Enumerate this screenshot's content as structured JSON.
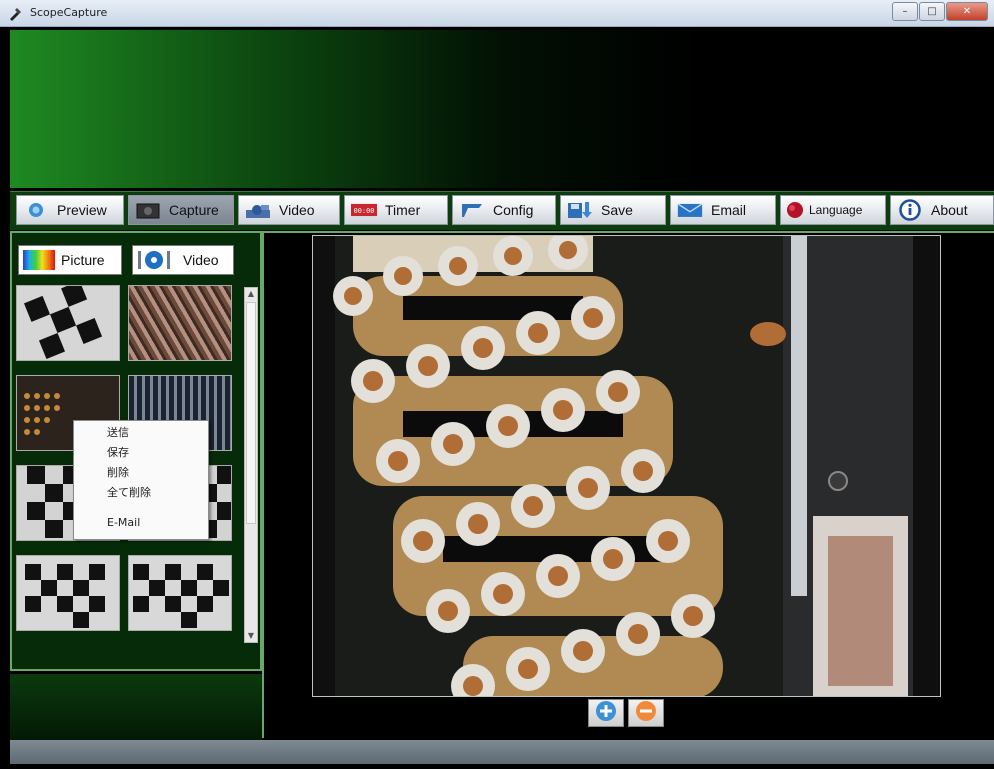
{
  "window": {
    "title": "ScopeCapture",
    "controls": {
      "minimize": "–",
      "maximize": "□",
      "close": "✕"
    }
  },
  "toolbar": {
    "buttons": [
      {
        "label": "Preview",
        "icon": "preview-icon"
      },
      {
        "label": "Capture",
        "icon": "camera-icon",
        "active": true
      },
      {
        "label": "Video",
        "icon": "video-camera-icon"
      },
      {
        "label": "Timer",
        "icon": "timer-icon"
      },
      {
        "label": "Config",
        "icon": "config-icon"
      },
      {
        "label": "Save",
        "icon": "save-icon"
      },
      {
        "label": "Email",
        "icon": "email-icon"
      },
      {
        "label": "Language",
        "icon": "language-icon"
      },
      {
        "label": "About",
        "icon": "info-icon"
      }
    ]
  },
  "gallery": {
    "tabs": [
      {
        "label": "Picture",
        "icon": "picture-icon"
      },
      {
        "label": "Video",
        "icon": "video-reel-icon"
      }
    ]
  },
  "context_menu": {
    "items": [
      "送信",
      "保存",
      "削除",
      "全て削除",
      "E-Mail"
    ]
  },
  "zoom": {
    "in_icon": "zoom-in-icon",
    "out_icon": "zoom-out-icon"
  },
  "colors": {
    "accent_green": "#1f8a22",
    "panel_border": "#6aa86a"
  }
}
